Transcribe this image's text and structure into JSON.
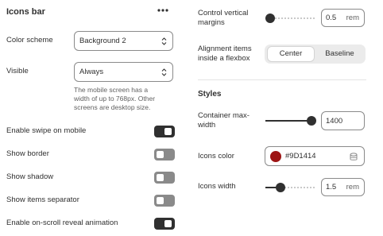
{
  "left": {
    "title": "Icons bar",
    "more_icon": "ellipsis-icon",
    "color_scheme": {
      "label": "Color scheme",
      "value": "Background 2"
    },
    "visible": {
      "label": "Visible",
      "value": "Always",
      "help": [
        "The mobile screen has a",
        "width of up to 768px. Other",
        "screens are desktop size."
      ]
    },
    "toggles": [
      {
        "label": "Enable swipe on mobile",
        "on": true
      },
      {
        "label": "Show border",
        "on": false
      },
      {
        "label": "Show shadow",
        "on": false
      },
      {
        "label": "Show items separator",
        "on": false
      },
      {
        "label": "Enable on-scroll reveal animation",
        "on": true
      }
    ]
  },
  "right": {
    "vertical_margins": {
      "label_lines": [
        "Control vertical",
        "margins"
      ],
      "value": "0.5",
      "unit": "rem",
      "fraction": 0.0
    },
    "alignment": {
      "label_lines": [
        "Alignment items",
        "inside a flexbox"
      ],
      "options": [
        "Center",
        "Baseline"
      ],
      "selected": "Center"
    },
    "styles_heading": "Styles",
    "container_width": {
      "label_lines": [
        "Container max-",
        "width"
      ],
      "value": "1400",
      "fraction": 1.0
    },
    "icons_color": {
      "label": "Icons color",
      "value": "#9D1414",
      "swatch": "#9D1414"
    },
    "icons_width": {
      "label": "Icons width",
      "value": "1.5",
      "unit": "rem",
      "fraction": 0.25
    }
  },
  "colors": {
    "toggle_on": "#303030",
    "toggle_off": "#8a8a8a",
    "thumb": "#303030"
  }
}
